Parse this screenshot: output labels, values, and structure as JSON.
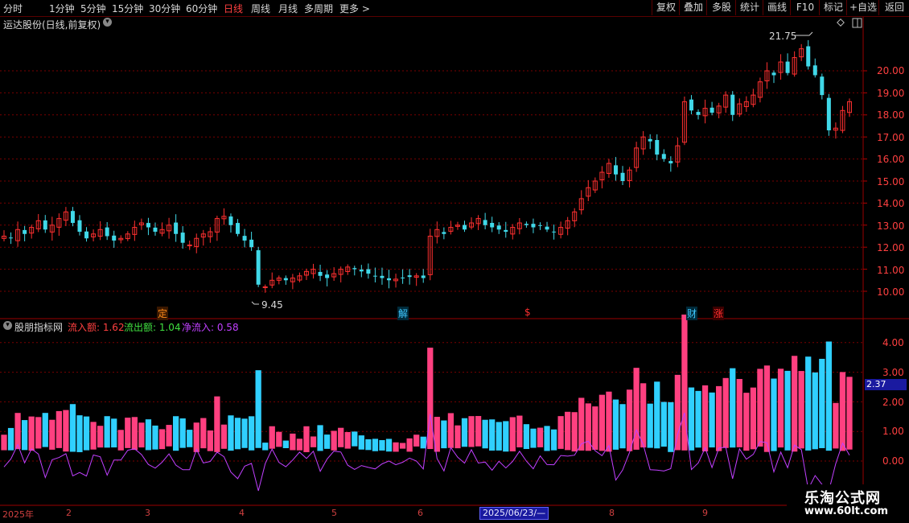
{
  "toolbar": {
    "periods": [
      "分时",
      "1分钟",
      "5分钟",
      "15分钟",
      "30分钟",
      "60分钟",
      "日线",
      "周线",
      "月线",
      "多周期",
      "更多 >"
    ],
    "active_period": "日线",
    "right_buttons": [
      "复权",
      "叠加",
      "多股",
      "统计",
      "画线",
      "F10",
      "标记",
      "+自选",
      "返回"
    ]
  },
  "main_chart": {
    "title": "运达股份(日线,前复权)",
    "price_labels": [
      "20.00",
      "19.00",
      "18.00",
      "17.00",
      "16.00",
      "15.00",
      "14.00",
      "13.00",
      "12.00",
      "11.00",
      "10.00"
    ],
    "high_label": "21.75",
    "low_label": "9.45",
    "markers": [
      {
        "text": "定",
        "color": "#ff8c1a"
      },
      {
        "text": "解",
        "color": "#40c8ff"
      },
      {
        "text": "$",
        "color": "#ff3030"
      },
      {
        "text": "财",
        "color": "#40c8ff"
      },
      {
        "text": "涨",
        "color": "#ff3030"
      }
    ]
  },
  "indicator": {
    "name": "股朋指标网",
    "inflow_label": "流入额: 1.62",
    "outflow_label": "流出额: 1.04",
    "net_label": "净流入: 0.58",
    "axis_labels": [
      "4.00",
      "3.00",
      "2.00",
      "1.00",
      "0.00"
    ],
    "current_value": "2.37"
  },
  "date_axis": {
    "labels": [
      "2025年",
      "2",
      "3",
      "4",
      "5",
      "6",
      "8",
      "9"
    ],
    "crosshair_date": "2025/06/23/—"
  },
  "watermark": {
    "title": "乐淘公式网",
    "url": "www.60lt.com"
  },
  "colors": {
    "up": "#ff3030",
    "down": "#40d8e8",
    "inflow_bar": "#ff4080",
    "outflow_bar": "#30d0ff",
    "net_line": "#c040ff",
    "grid": "#7a0000"
  },
  "chart_data": {
    "type": "candlestick",
    "ylim": [
      9.0,
      22.0
    ],
    "closes": [
      12.5,
      12.4,
      12.8,
      12.6,
      12.9,
      13.2,
      12.8,
      13.0,
      13.3,
      13.6,
      13.1,
      12.7,
      12.4,
      12.6,
      12.8,
      12.5,
      12.3,
      12.4,
      12.6,
      12.9,
      13.1,
      12.9,
      12.7,
      12.8,
      13.0,
      12.6,
      12.2,
      12.1,
      12.4,
      12.6,
      12.7,
      13.3,
      13.4,
      13.0,
      12.6,
      12.3,
      12.0,
      10.3,
      10.2,
      10.5,
      10.6,
      10.5,
      10.6,
      10.7,
      10.9,
      11.0,
      10.7,
      10.6,
      10.8,
      11.0,
      11.1,
      11.0,
      10.9,
      10.8,
      10.7,
      10.6,
      10.5,
      10.55,
      10.6,
      10.65,
      10.7,
      10.6,
      12.5,
      12.8,
      12.6,
      12.9,
      13.0,
      12.8,
      13.1,
      13.3,
      13.0,
      12.9,
      12.8,
      12.7,
      12.9,
      13.1,
      13.0,
      12.9,
      13.0,
      12.8,
      12.7,
      12.9,
      13.2,
      13.6,
      14.2,
      14.7,
      15.0,
      15.4,
      15.8,
      15.3,
      15.0,
      15.5,
      16.5,
      17.0,
      16.8,
      16.2,
      16.0,
      15.8,
      16.6,
      18.6,
      18.2,
      18.0,
      18.3,
      18.1,
      18.4,
      18.9,
      18.0,
      18.5,
      18.6,
      18.9,
      19.5,
      20.0,
      19.8,
      20.4,
      19.9,
      20.6,
      21.0,
      20.2,
      19.8,
      18.9,
      17.3,
      17.4,
      18.2,
      18.6
    ]
  }
}
